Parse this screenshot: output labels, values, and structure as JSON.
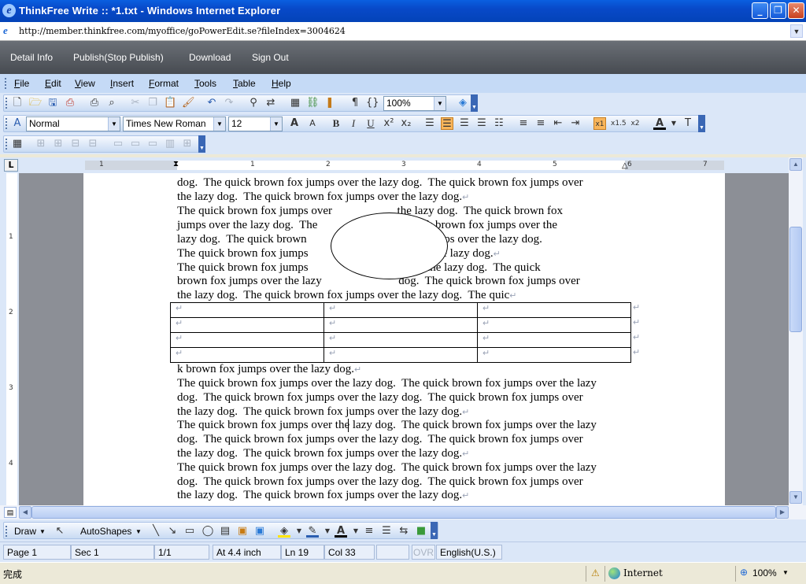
{
  "window": {
    "title": "ThinkFree Write :: *1.txt - Windows Internet Explorer",
    "minimize": "_",
    "restore": "❐",
    "close": "✕"
  },
  "address": {
    "url": "http://member.thinkfree.com/myoffice/goPowerEdit.se?fileIndex=3004624",
    "dropdown": "▼"
  },
  "app_menu": {
    "items": [
      "Detail Info",
      "Publish(Stop Publish)",
      "Download",
      "Sign Out"
    ]
  },
  "menubar": {
    "items": [
      {
        "accel": "F",
        "rest": "ile"
      },
      {
        "accel": "E",
        "rest": "dit"
      },
      {
        "accel": "V",
        "rest": "iew"
      },
      {
        "accel": "I",
        "rest": "nsert"
      },
      {
        "accel": "F",
        "rest": "ormat"
      },
      {
        "accel": "T",
        "rest": "ools"
      },
      {
        "accel": "T",
        "rest": "able"
      },
      {
        "accel": "H",
        "rest": "elp"
      }
    ]
  },
  "standard_toolbar": {
    "zoom": "100%"
  },
  "format_toolbar": {
    "style": "Normal",
    "font": "Times New Roman",
    "size": "12",
    "bold": "B",
    "italic": "I",
    "underline": "U"
  },
  "ruler": {
    "marks": [
      "1",
      "1",
      "2",
      "3",
      "4",
      "5",
      "6",
      "7"
    ],
    "vmarks": [
      "1",
      "2",
      "3",
      "4"
    ]
  },
  "document": {
    "lines": [
      "dog.  The quick brown fox jumps over the lazy dog.  The quick brown fox jumps over",
      "the lazy dog.  The quick brown fox jumps over the lazy dog.",
      "The quick brown fox jumps over                      the lazy dog.  The quick brown fox",
      "jumps over the lazy dog.  The                              quick brown fox jumps over the",
      "lazy dog.  The quick brown                                  fox jumps over the lazy dog.",
      "The quick brown fox jumps                                  over the lazy dog.",
      "The quick brown fox jumps                                over the lazy dog.  The quick",
      "brown fox jumps over the lazy                          dog.  The quick brown fox jumps over",
      "the lazy dog.  The quick brown fox jumps over the lazy dog.  The quic",
      "k brown fox jumps over the lazy dog.",
      "The quick brown fox jumps over the lazy dog.  The quick brown fox jumps over the lazy",
      "dog.  The quick brown fox jumps over the lazy dog.  The quick brown fox jumps over",
      "the lazy dog.  The quick brown fox jumps over the lazy dog.",
      "The quick brown fox jumps over the lazy dog.  The quick brown fox jumps over the lazy",
      "dog.  The quick brown fox jumps over the lazy dog.  The quick brown fox jumps over",
      "the lazy dog.  The quick brown fox jumps over the lazy dog.",
      "The quick brown fox jumps over the lazy dog.  The quick brown fox jumps over the lazy",
      "dog.  The quick brown fox jumps over the lazy dog.  The quick brown fox jumps over",
      "the lazy dog.  The quick brown fox jumps over the lazy dog."
    ],
    "paragraph_mark": "↵",
    "table_rows": 4,
    "table_cols": 3
  },
  "drawing_toolbar": {
    "draw": "Draw",
    "autoshapes": "AutoShapes"
  },
  "status": {
    "page": "Page 1",
    "sec": "Sec 1",
    "count": "1/1",
    "at": "At 4.4 inch",
    "ln": "Ln 19",
    "col": "Col 33",
    "ovr": "OVR",
    "lang": "English(U.S.)"
  },
  "ie_status": {
    "done": "完成",
    "zone": "Internet",
    "zoom": "100%"
  }
}
